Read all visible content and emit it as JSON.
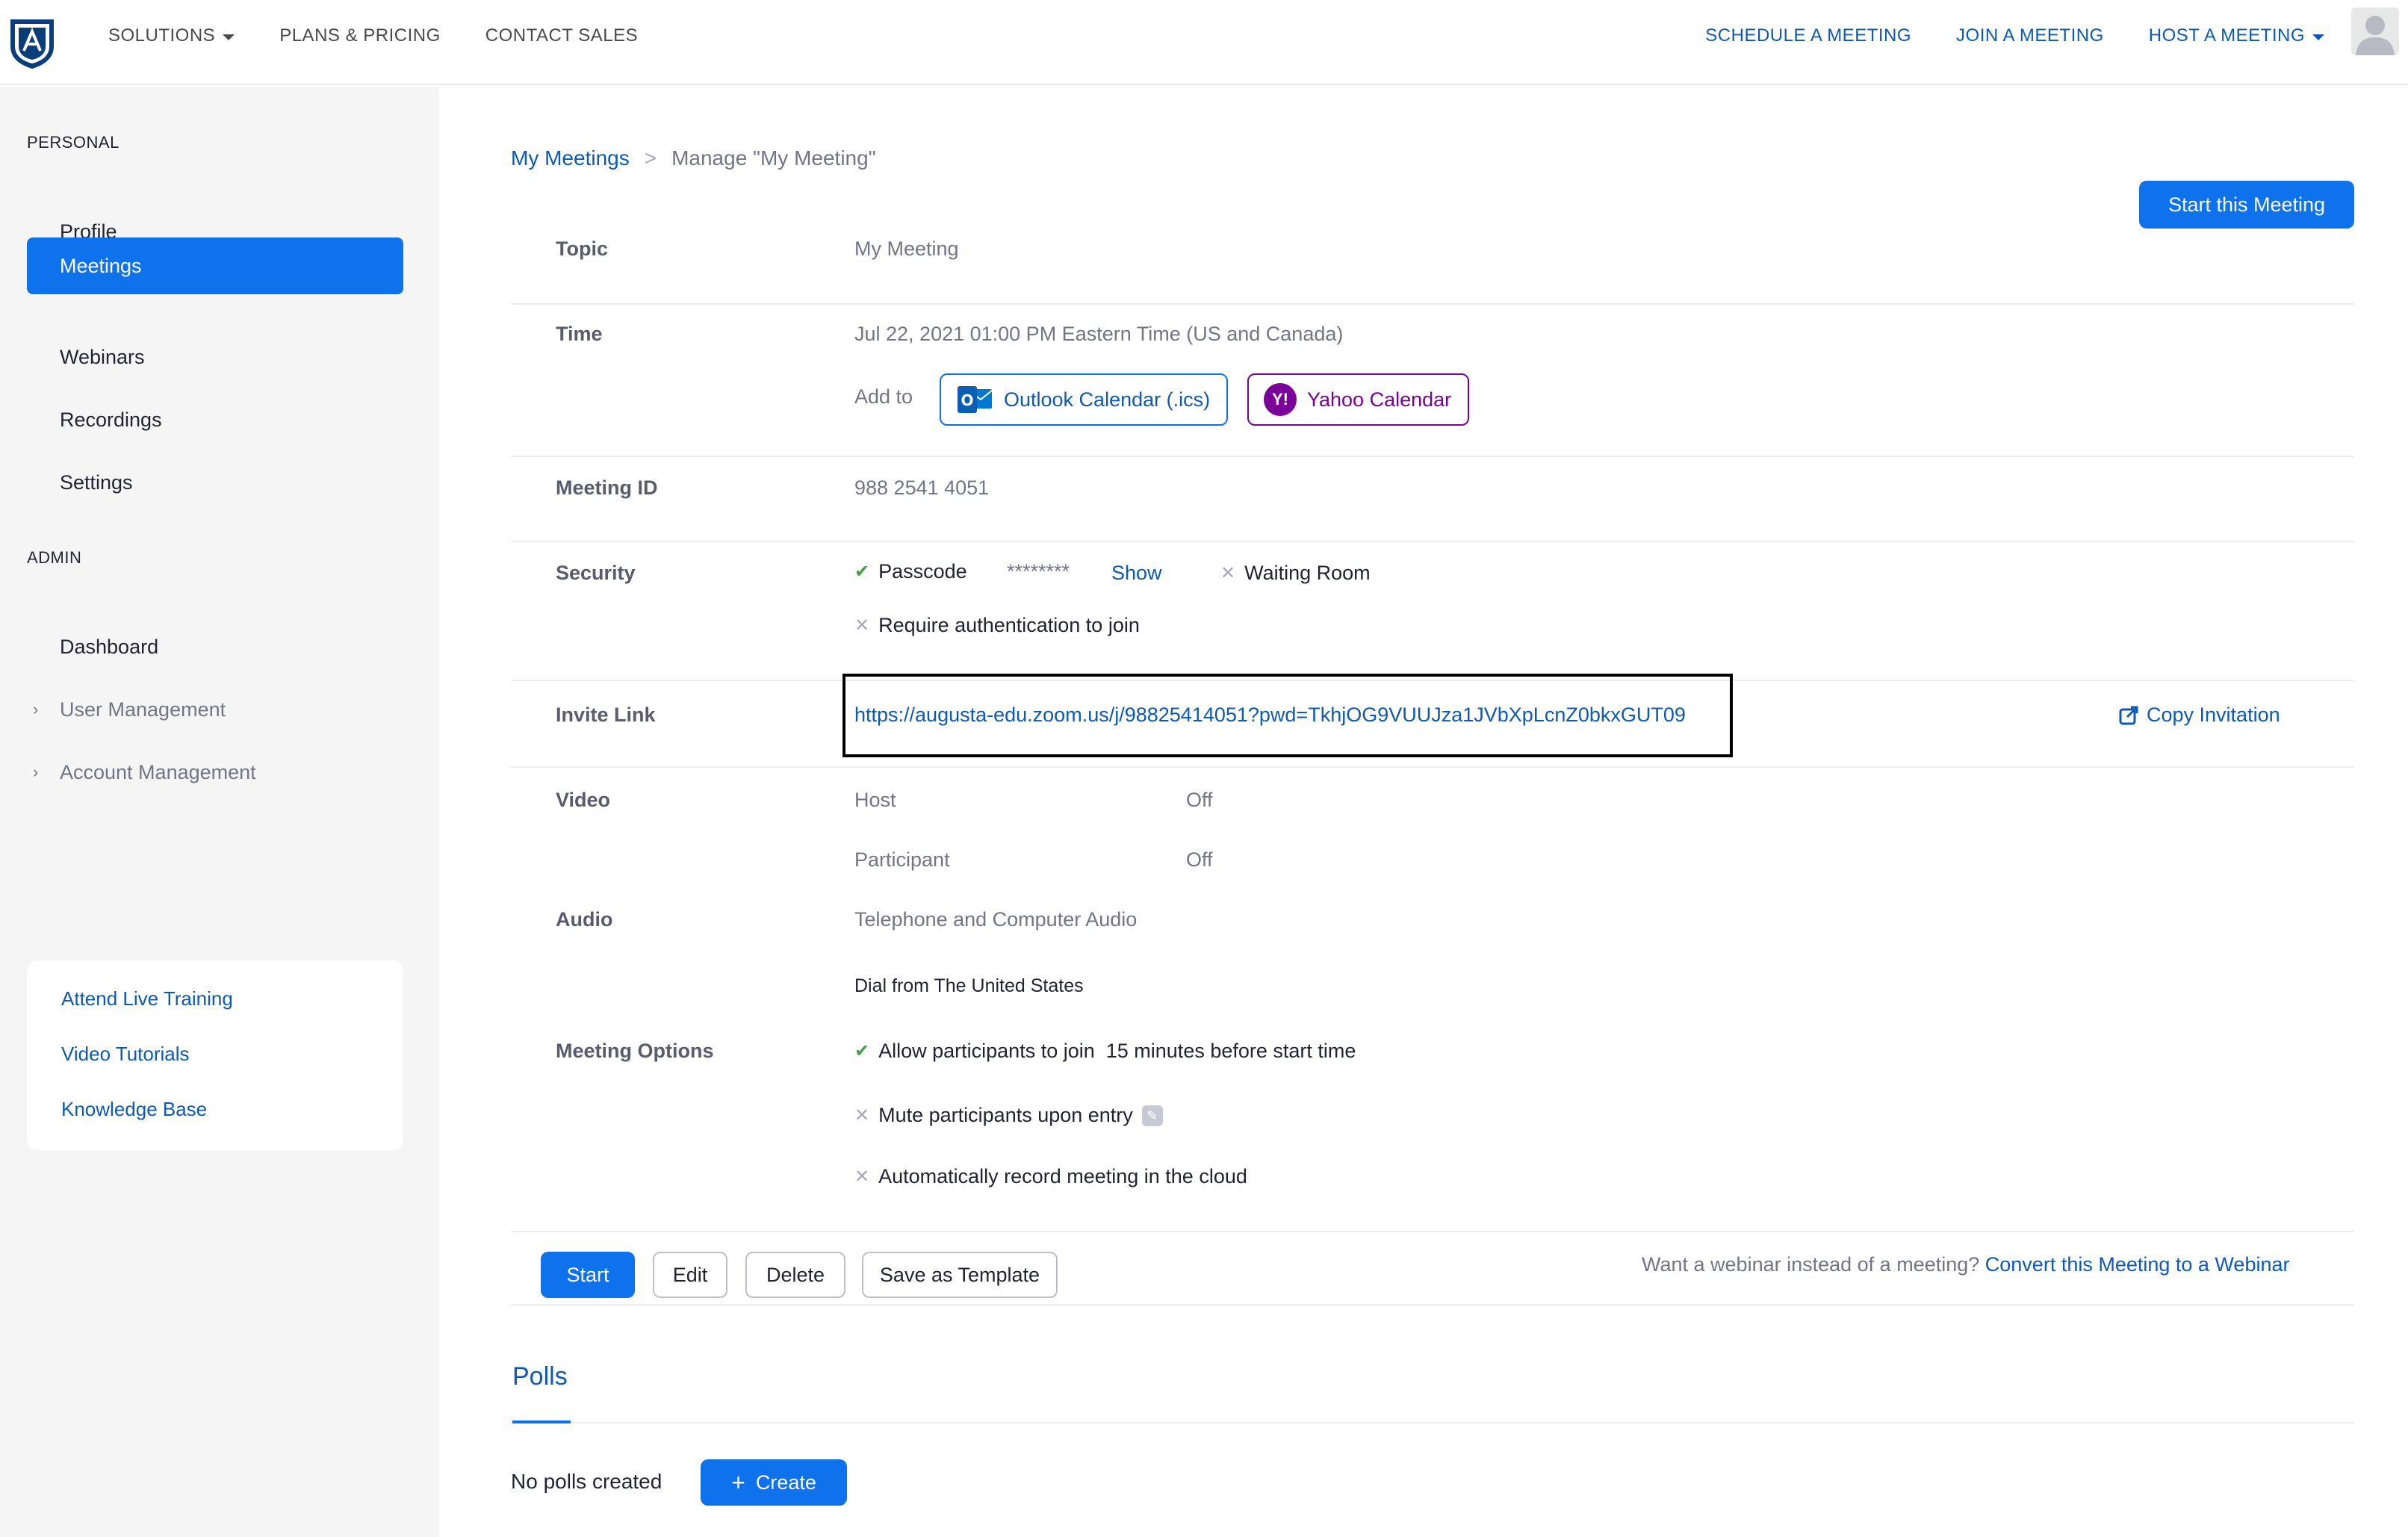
{
  "nav": {
    "left": [
      "SOLUTIONS",
      "PLANS & PRICING",
      "CONTACT SALES"
    ],
    "right": [
      "SCHEDULE A MEETING",
      "JOIN A MEETING",
      "HOST A MEETING"
    ]
  },
  "sidebar": {
    "personal_heading": "PERSONAL",
    "personal_items": [
      "Profile",
      "Meetings",
      "Webinars",
      "Recordings",
      "Settings"
    ],
    "active_item": "Meetings",
    "admin_heading": "ADMIN",
    "admin_items": [
      "Dashboard",
      "User Management",
      "Account Management"
    ],
    "help_links": [
      "Attend Live Training",
      "Video Tutorials",
      "Knowledge Base"
    ]
  },
  "breadcrumb": {
    "root": "My Meetings",
    "separator": ">",
    "current": "Manage \"My Meeting\""
  },
  "start_meeting_button": "Start this Meeting",
  "details": {
    "topic_label": "Topic",
    "topic_value": "My Meeting",
    "time_label": "Time",
    "time_value": "Jul 22, 2021 01:00 PM Eastern Time (US and Canada)",
    "add_to_label": "Add to",
    "outlook_label": "Outlook Calendar (.ics)",
    "yahoo_label": "Yahoo Calendar",
    "meeting_id_label": "Meeting ID",
    "meeting_id_value": "988 2541 4051",
    "security_label": "Security",
    "passcode_label": "Passcode",
    "passcode_mask": "********",
    "show_label": "Show",
    "waiting_room_label": "Waiting Room",
    "require_auth_label": "Require authentication to join",
    "invite_label": "Invite Link",
    "invite_url": "https://augusta-edu.zoom.us/j/98825414051?pwd=TkhjOG9VUUJza1JVbXpLcnZ0bkxGUT09",
    "copy_invitation_label": "Copy Invitation",
    "video_label": "Video",
    "host_label": "Host",
    "host_value": "Off",
    "participant_label": "Participant",
    "participant_value": "Off",
    "audio_label": "Audio",
    "audio_value": "Telephone and Computer Audio",
    "dial_from": "Dial from The United States",
    "options_label": "Meeting Options",
    "option_join_before": "Allow participants to join  15 minutes before start time",
    "option_mute": "Mute participants upon entry",
    "option_record": "Automatically record meeting in the cloud"
  },
  "actions": {
    "start": "Start",
    "edit": "Edit",
    "delete": "Delete",
    "save_template": "Save as Template"
  },
  "webinar_hint": {
    "prefix": "Want a webinar instead of a meeting?",
    "link": "Convert this Meeting to a Webinar"
  },
  "polls": {
    "tab_label": "Polls",
    "empty_text": "No polls created",
    "create_label": "Create"
  },
  "colors": {
    "accent": "#0e72ed",
    "link": "#0e5ab3",
    "yahoo": "#7b0099"
  }
}
